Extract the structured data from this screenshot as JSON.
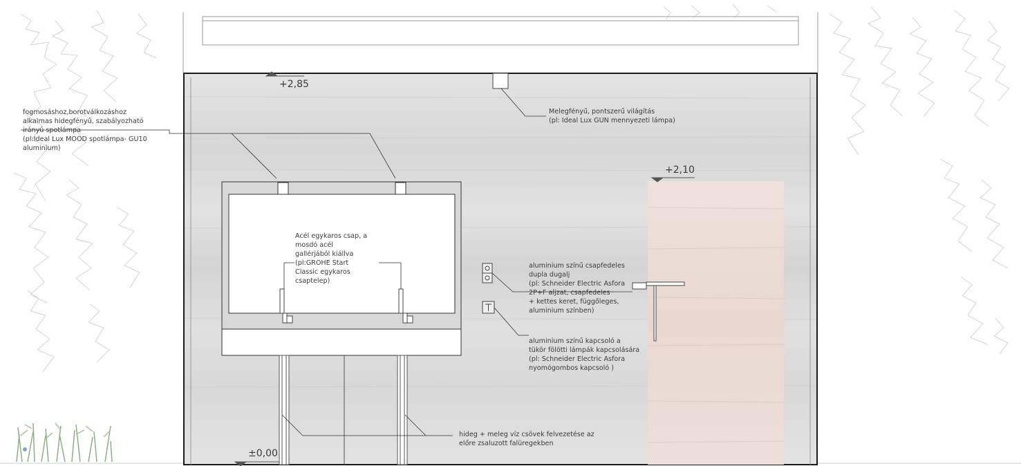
{
  "levels": {
    "ceiling": "+2,85",
    "door_top": "+2,10",
    "floor": "±0,00"
  },
  "annotations": {
    "spotlight": "fogmosáshoz,borotválkozáshoz\nalkalmas hidegfényű, szabályozható\nirányú spotlámpa\n(pl:Ideal Lux MOOD spotlámpa- GU10\naluminium)",
    "ceiling_light": "Melegfényű, pontszerű világítás\n(pl: Ideal Lux GUN mennyezeti lámpa)",
    "faucet": "Acél egykaros csap, a\nmosdó acél\ngallérjából kiállva\n(pl:GROHE Start\nClassic egykaros\ncsaptelep)",
    "socket": " aluminium színű csapfedeles\ndupla dugalj\n(pl: Schneider Electric Asfora\n2P+F aljzat, csapfedeles\n + kettes keret, függőleges,\naluminium színben)",
    "switch": "aluminium színű kapcsoló a\ntükör fölötti lámpák kapcsolására\n(pl: Schneider Electric Asfora\nnyomógombos kapcsoló )",
    "pipes": "hideg + meleg víz csövek felvezetése az\nelőre zsaluzott falüregekben"
  },
  "colors": {
    "concrete": "#dedede",
    "wood": "#ecdcd6",
    "line": "#222222"
  }
}
